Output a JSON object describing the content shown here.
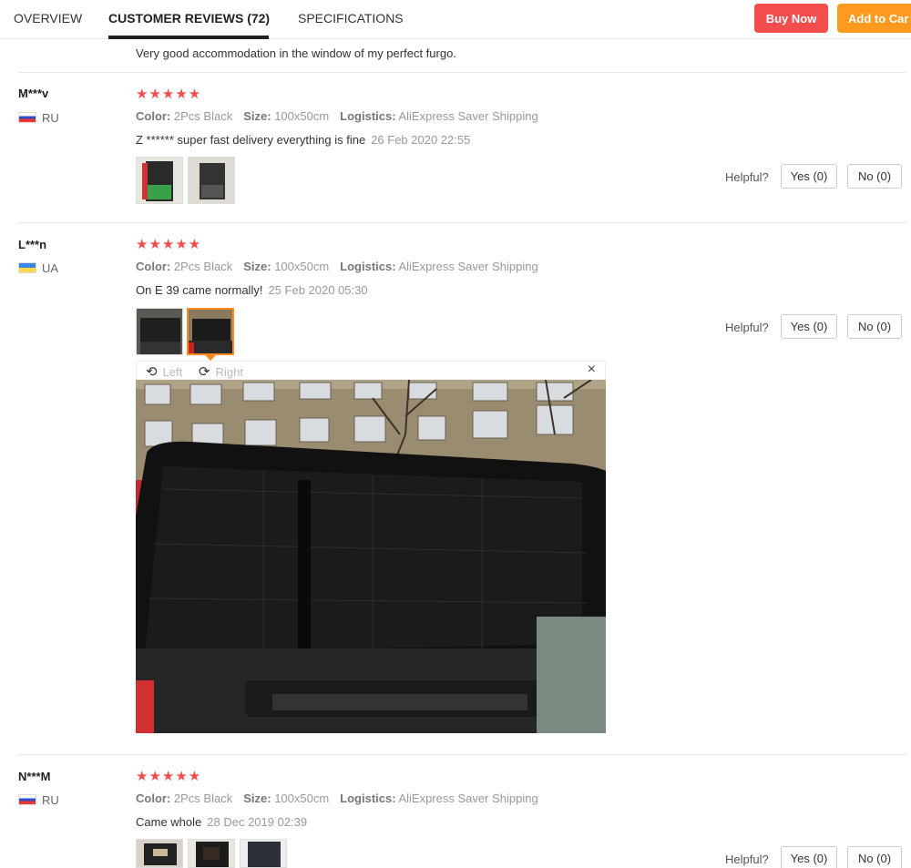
{
  "tabs": [
    {
      "label": "OVERVIEW"
    },
    {
      "label": "CUSTOMER REVIEWS (72)"
    },
    {
      "label": "SPECIFICATIONS"
    }
  ],
  "actions": {
    "buy_now": "Buy Now",
    "add_to_cart": "Add to Car"
  },
  "previous_review_text": "Very good accommodation in the window of my perfect furgo.",
  "attr_labels": {
    "color": "Color:",
    "size": "Size:",
    "logistics": "Logistics:"
  },
  "helpful_label": "Helpful?",
  "viewer": {
    "rotate_left": "Left",
    "rotate_right": "Right",
    "close": "×"
  },
  "reviews": [
    {
      "user": "M***v",
      "country": "RU",
      "flag": "ru",
      "stars": "★★★★★",
      "color": "2Pcs Black",
      "size": "100x50cm",
      "logistics": "AliExpress Saver Shipping",
      "text": "Z ****** super fast delivery everything is fine",
      "date": "26 Feb 2020 22:55",
      "yes": "Yes (0)",
      "no": "No (0)"
    },
    {
      "user": "L***n",
      "country": "UA",
      "flag": "ua",
      "stars": "★★★★★",
      "color": "2Pcs Black",
      "size": "100x50cm",
      "logistics": "AliExpress Saver Shipping",
      "text": "On E 39 came normally!",
      "date": "25 Feb 2020 05:30",
      "yes": "Yes (0)",
      "no": "No (0)"
    },
    {
      "user": "N***M",
      "country": "RU",
      "flag": "ru",
      "stars": "★★★★★",
      "color": "2Pcs Black",
      "size": "100x50cm",
      "logistics": "AliExpress Saver Shipping",
      "text": "Came whole",
      "date": "28 Dec 2019 02:39",
      "yes": "Yes (0)",
      "no": "No (0)"
    }
  ],
  "colors": {
    "accent_red": "#f44d4d",
    "accent_orange": "#ff9a1f",
    "star": "#f44d4d",
    "selected_thumb": "#ff8a1f"
  }
}
